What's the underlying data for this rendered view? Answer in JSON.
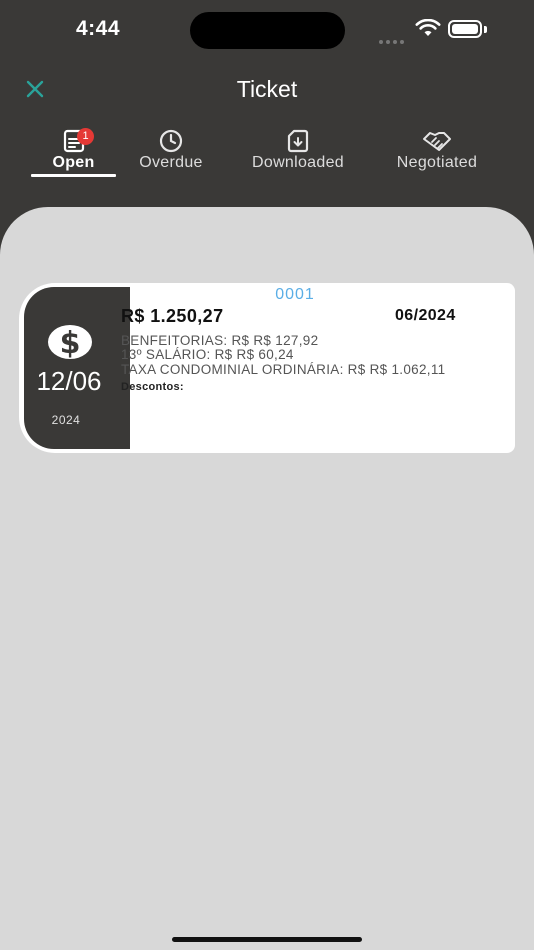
{
  "status_bar": {
    "time": "4:44"
  },
  "header": {
    "title": "Ticket"
  },
  "tabs": [
    {
      "label": "Open",
      "icon": "document-icon",
      "active": true,
      "badge": "1"
    },
    {
      "label": "Overdue",
      "icon": "clock-icon",
      "active": false
    },
    {
      "label": "Downloaded",
      "icon": "download-icon",
      "active": false
    },
    {
      "label": "Negotiated",
      "icon": "handshake-icon",
      "active": false
    }
  ],
  "ticket": {
    "day_month": "12/06",
    "year": "2024",
    "code": "0001",
    "amount": "R$ 1.250,27",
    "reference": "06/2024",
    "items": [
      "BENFEITORIAS: R$ R$ 127,92",
      "13º SALÁRIO: R$ R$ 60,24",
      "TAXA CONDOMINIAL ORDINÁRIA: R$ R$ 1.062,11"
    ],
    "discounts_label": "Descontos:"
  },
  "colors": {
    "header_bg": "#3a3937",
    "content_bg": "#d8d8d8",
    "close_icon": "#2aa39a",
    "code_text": "#5aaee6",
    "badge": "#e53935"
  }
}
